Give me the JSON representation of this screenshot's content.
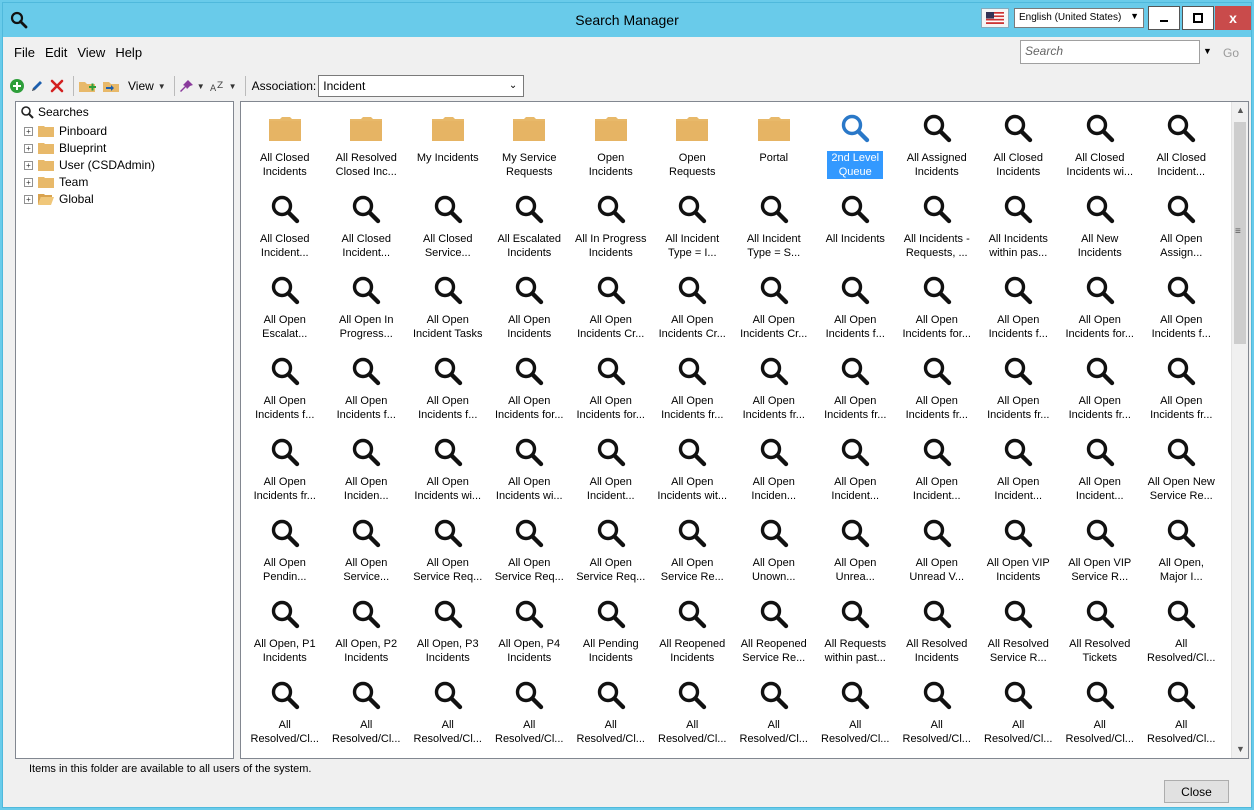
{
  "window": {
    "title": "Search Manager",
    "language": "English (United States)",
    "close_glyph": "x"
  },
  "menu": {
    "items": [
      "File",
      "Edit",
      "View",
      "Help"
    ]
  },
  "search": {
    "placeholder": "Search",
    "go_label": "Go"
  },
  "toolbar": {
    "view_label": "View",
    "association_label": "Association:",
    "association_value": "Incident",
    "icons": [
      "add-icon",
      "edit-icon",
      "delete-icon",
      "new-folder-icon",
      "folder-icon",
      "pin-icon",
      "font-icon"
    ]
  },
  "tree": {
    "root_label": "Searches",
    "nodes": [
      {
        "label": "Pinboard"
      },
      {
        "label": "Blueprint"
      },
      {
        "label": "User (CSDAdmin)"
      },
      {
        "label": "Team"
      },
      {
        "label": "Global",
        "selected": true
      }
    ]
  },
  "items": [
    {
      "label": "All Closed\nIncidents",
      "icon": "folder"
    },
    {
      "label": "All Resolved\nClosed Inc...",
      "icon": "folder"
    },
    {
      "label": "My Incidents",
      "icon": "folder"
    },
    {
      "label": "My Service\nRequests",
      "icon": "folder"
    },
    {
      "label": "Open\nIncidents",
      "icon": "folder"
    },
    {
      "label": "Open\nRequests",
      "icon": "folder"
    },
    {
      "label": "Portal",
      "icon": "folder"
    },
    {
      "label": "2nd Level\nQueue",
      "icon": "search",
      "selected": true
    },
    {
      "label": "All Assigned\nIncidents",
      "icon": "search"
    },
    {
      "label": "All Closed\nIncidents",
      "icon": "search"
    },
    {
      "label": "All Closed\nIncidents wi...",
      "icon": "search"
    },
    {
      "label": "All Closed\nIncident...",
      "icon": "search"
    },
    {
      "label": "All Closed\nIncident...",
      "icon": "search"
    },
    {
      "label": "All Closed\nIncident...",
      "icon": "search"
    },
    {
      "label": "All Closed\nService...",
      "icon": "search"
    },
    {
      "label": "All Escalated\nIncidents",
      "icon": "search"
    },
    {
      "label": "All In Progress\nIncidents",
      "icon": "search"
    },
    {
      "label": "All Incident\nType = I...",
      "icon": "search"
    },
    {
      "label": "All Incident\nType = S...",
      "icon": "search"
    },
    {
      "label": "All Incidents",
      "icon": "search"
    },
    {
      "label": "All Incidents -\nRequests, ...",
      "icon": "search"
    },
    {
      "label": "All Incidents\nwithin pas...",
      "icon": "search"
    },
    {
      "label": "All New\nIncidents",
      "icon": "search"
    },
    {
      "label": "All Open\nAssign...",
      "icon": "search"
    },
    {
      "label": "All Open\nEscalat...",
      "icon": "search"
    },
    {
      "label": "All Open In\nProgress...",
      "icon": "search"
    },
    {
      "label": "All Open\nIncident Tasks",
      "icon": "search"
    },
    {
      "label": "All Open\nIncidents",
      "icon": "search"
    },
    {
      "label": "All Open\nIncidents Cr...",
      "icon": "search"
    },
    {
      "label": "All Open\nIncidents Cr...",
      "icon": "search"
    },
    {
      "label": "All Open\nIncidents Cr...",
      "icon": "search"
    },
    {
      "label": "All Open\nIncidents f...",
      "icon": "search"
    },
    {
      "label": "All Open\nIncidents for...",
      "icon": "search"
    },
    {
      "label": "All Open\nIncidents f...",
      "icon": "search"
    },
    {
      "label": "All Open\nIncidents for...",
      "icon": "search"
    },
    {
      "label": "All Open\nIncidents f...",
      "icon": "search"
    },
    {
      "label": "All Open\nIncidents f...",
      "icon": "search"
    },
    {
      "label": "All Open\nIncidents f...",
      "icon": "search"
    },
    {
      "label": "All Open\nIncidents f...",
      "icon": "search"
    },
    {
      "label": "All Open\nIncidents for...",
      "icon": "search"
    },
    {
      "label": "All Open\nIncidents for...",
      "icon": "search"
    },
    {
      "label": "All Open\nIncidents fr...",
      "icon": "search"
    },
    {
      "label": "All Open\nIncidents fr...",
      "icon": "search"
    },
    {
      "label": "All Open\nIncidents fr...",
      "icon": "search"
    },
    {
      "label": "All Open\nIncidents fr...",
      "icon": "search"
    },
    {
      "label": "All Open\nIncidents fr...",
      "icon": "search"
    },
    {
      "label": "All Open\nIncidents fr...",
      "icon": "search"
    },
    {
      "label": "All Open\nIncidents fr...",
      "icon": "search"
    },
    {
      "label": "All Open\nIncidents fr...",
      "icon": "search"
    },
    {
      "label": "All Open\nInciden...",
      "icon": "search"
    },
    {
      "label": "All Open\nIncidents wi...",
      "icon": "search"
    },
    {
      "label": "All Open\nIncidents wi...",
      "icon": "search"
    },
    {
      "label": "All Open\nIncident...",
      "icon": "search"
    },
    {
      "label": "All Open\nIncidents wit...",
      "icon": "search"
    },
    {
      "label": "All Open\nInciden...",
      "icon": "search"
    },
    {
      "label": "All Open\nIncident...",
      "icon": "search"
    },
    {
      "label": "All Open\nIncident...",
      "icon": "search"
    },
    {
      "label": "All Open\nIncident...",
      "icon": "search"
    },
    {
      "label": "All Open\nIncident...",
      "icon": "search"
    },
    {
      "label": "All Open New\nService Re...",
      "icon": "search"
    },
    {
      "label": "All Open\nPendin...",
      "icon": "search"
    },
    {
      "label": "All Open\nService...",
      "icon": "search"
    },
    {
      "label": "All Open\nService Req...",
      "icon": "search"
    },
    {
      "label": "All Open\nService Req...",
      "icon": "search"
    },
    {
      "label": "All Open\nService Req...",
      "icon": "search"
    },
    {
      "label": "All Open\nService Re...",
      "icon": "search"
    },
    {
      "label": "All Open\nUnown...",
      "icon": "search"
    },
    {
      "label": "All Open\nUnrea...",
      "icon": "search"
    },
    {
      "label": "All Open\nUnread V...",
      "icon": "search"
    },
    {
      "label": "All Open VIP\nIncidents",
      "icon": "search"
    },
    {
      "label": "All Open VIP\nService R...",
      "icon": "search"
    },
    {
      "label": "All Open,\nMajor I...",
      "icon": "search"
    },
    {
      "label": "All Open, P1\nIncidents",
      "icon": "search"
    },
    {
      "label": "All Open, P2\nIncidents",
      "icon": "search"
    },
    {
      "label": "All Open, P3\nIncidents",
      "icon": "search"
    },
    {
      "label": "All Open, P4\nIncidents",
      "icon": "search"
    },
    {
      "label": "All Pending\nIncidents",
      "icon": "search"
    },
    {
      "label": "All Reopened\nIncidents",
      "icon": "search"
    },
    {
      "label": "All Reopened\nService Re...",
      "icon": "search"
    },
    {
      "label": "All Requests\nwithin past...",
      "icon": "search"
    },
    {
      "label": "All Resolved\nIncidents",
      "icon": "search"
    },
    {
      "label": "All Resolved\nService R...",
      "icon": "search"
    },
    {
      "label": "All Resolved\nTickets",
      "icon": "search"
    },
    {
      "label": "All\nResolved/Cl...",
      "icon": "search"
    },
    {
      "label": "All\nResolved/Cl...",
      "icon": "search"
    },
    {
      "label": "All\nResolved/Cl...",
      "icon": "search"
    },
    {
      "label": "All\nResolved/Cl...",
      "icon": "search"
    },
    {
      "label": "All\nResolved/Cl...",
      "icon": "search"
    },
    {
      "label": "All\nResolved/Cl...",
      "icon": "search"
    },
    {
      "label": "All\nResolved/Cl...",
      "icon": "search"
    },
    {
      "label": "All\nResolved/Cl...",
      "icon": "search"
    },
    {
      "label": "All\nResolved/Cl...",
      "icon": "search"
    },
    {
      "label": "All\nResolved/Cl...",
      "icon": "search"
    },
    {
      "label": "All\nResolved/Cl...",
      "icon": "search"
    },
    {
      "label": "All\nResolved/Cl...",
      "icon": "search"
    },
    {
      "label": "All\nResolved/Cl...",
      "icon": "search"
    }
  ],
  "status_text": "Items in this folder are available to all users of the system.",
  "close_button": "Close",
  "colors": {
    "titlebar": "#69cbea",
    "folder": "#e8b96a",
    "selection": "#3399ff",
    "close_red": "#c94b4b"
  }
}
